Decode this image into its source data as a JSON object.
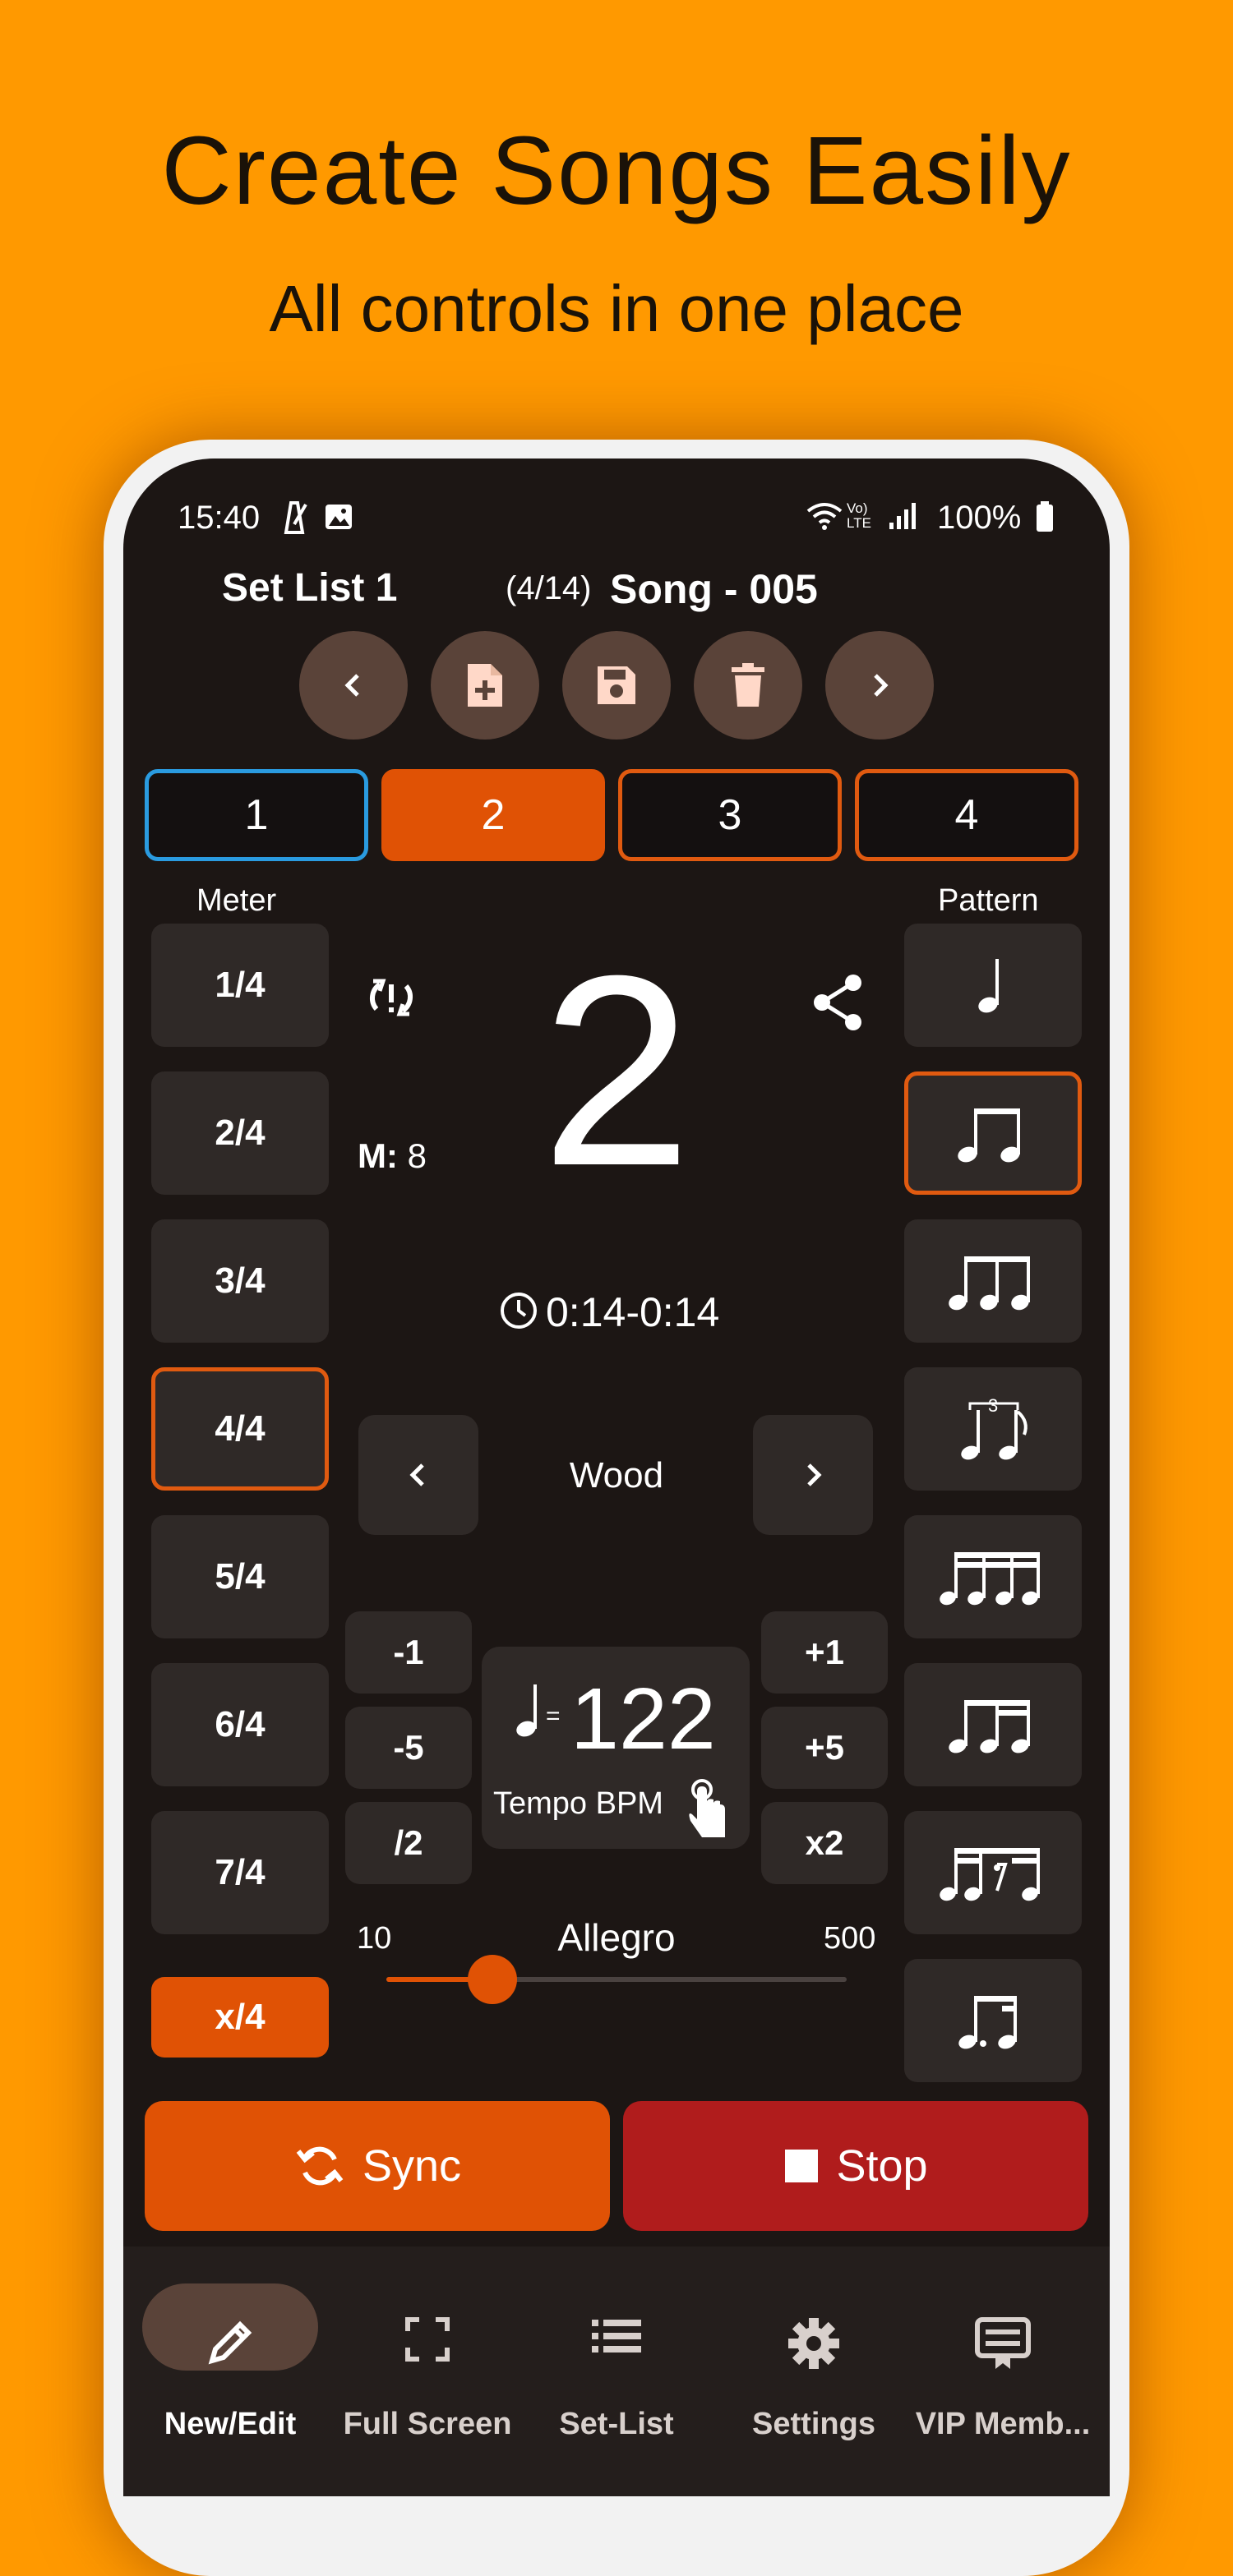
{
  "promo": {
    "headline": "Create Songs Easily",
    "subline": "All controls in one place"
  },
  "status_bar": {
    "time": "15:40",
    "battery": "100%",
    "net_label": "Vo) LTE"
  },
  "header": {
    "set_list": "Set List 1",
    "song_count": "(4/14)",
    "song_name": "Song - 005"
  },
  "sections": [
    {
      "label": "1"
    },
    {
      "label": "2"
    },
    {
      "label": "3"
    },
    {
      "label": "4"
    }
  ],
  "meter": {
    "label": "Meter",
    "items": [
      "1/4",
      "2/4",
      "3/4",
      "4/4",
      "5/4",
      "6/4",
      "7/4",
      "x/4"
    ],
    "selected": "4/4"
  },
  "pattern": {
    "label": "Pattern"
  },
  "display": {
    "beat": "2",
    "measure_prefix": "M:",
    "measure_value": "8",
    "time_range": "0:14-0:14"
  },
  "sound": {
    "name": "Wood"
  },
  "tempo": {
    "decrements": [
      "-1",
      "-5",
      "/2"
    ],
    "increments": [
      "+1",
      "+5",
      "x2"
    ],
    "equals": "=",
    "bpm": "122",
    "label": "Tempo BPM",
    "min": "10",
    "max": "500",
    "name": "Allegro",
    "slider_fraction": 0.23
  },
  "controls": {
    "sync_label": "Sync",
    "stop_label": "Stop"
  },
  "nav": {
    "items": [
      "New/Edit",
      "Full Screen",
      "Set-List",
      "Settings",
      "VIP Memb..."
    ]
  },
  "colors": {
    "background": "#FF9900",
    "accent": "#E05205",
    "stop": "#B01C1C",
    "selected_outline_blue": "#2A9BE0"
  }
}
